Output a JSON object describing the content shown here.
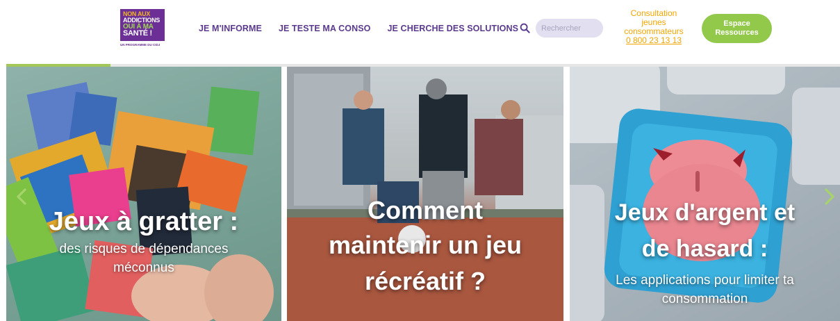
{
  "logo": {
    "line1": "NON AUX",
    "line2": "ADDICTIONS",
    "line3": "OUI À MA",
    "line4": "SANTÉ !",
    "subtitle": "UN PROGRAMME DU CIDJ"
  },
  "nav": {
    "items": [
      {
        "label": "JE M'INFORME"
      },
      {
        "label": "JE TESTE MA CONSO"
      },
      {
        "label": "JE CHERCHE DES SOLUTIONS"
      }
    ]
  },
  "search": {
    "placeholder": "Rechercher",
    "value": ""
  },
  "consultation": {
    "line1": "Consultation",
    "line2": "jeunes",
    "line3": "consommateurs",
    "phone": "0 800 23 13 13"
  },
  "espace_button": {
    "line1": "Espace",
    "line2": "Ressources"
  },
  "carousel": {
    "progress": 0.125,
    "slides": [
      {
        "title": "Jeux à gratter :",
        "subtitle_line1": "des risques de dépendances",
        "subtitle_line2": "méconnus"
      },
      {
        "title_line1": "Comment",
        "title_line2": "maintenir un jeu",
        "title_line3": "récréatif ?"
      },
      {
        "title_line1": "Jeux d'argent et",
        "title_line2": "de hasard :",
        "subtitle_line1": "Les applications pour limiter ta",
        "subtitle_line2": "consommation"
      }
    ]
  },
  "colors": {
    "brand_purple": "#6b2f95",
    "nav_purple": "#5b3a8e",
    "accent_orange": "#f0a500",
    "accent_green": "#93c94b"
  },
  "icons": {
    "search": "search-icon",
    "prev": "chevron-left-icon",
    "next": "chevron-right-icon"
  }
}
